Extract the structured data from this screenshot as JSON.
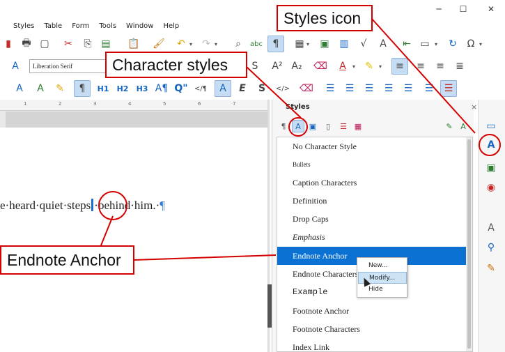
{
  "window": {
    "minimize": "─",
    "maximize": "☐",
    "close": "✕"
  },
  "menu": [
    "Styles",
    "Table",
    "Form",
    "Tools",
    "Window",
    "Help"
  ],
  "toolbar": {
    "font_name": "Liberation Serif"
  },
  "ruler": {
    "ticks": [
      "1",
      "2",
      "3",
      "4",
      "5",
      "6",
      "7"
    ]
  },
  "document": {
    "text_before": "e·heard·quiet·steps",
    "text_after": "·behind·him.·",
    "pilcrow": "¶"
  },
  "styles_panel": {
    "title": "Styles",
    "close": "×",
    "items": [
      "No Character Style",
      "Bullets",
      "Caption Characters",
      "Definition",
      "Drop Caps",
      "Emphasis",
      "Endnote Anchor",
      "Endnote Characters",
      "Example",
      "Footnote Anchor",
      "Footnote Characters",
      "Index Link"
    ],
    "selected": "Endnote Anchor"
  },
  "context_menu": {
    "items": [
      "New...",
      "Modify...",
      "Hide"
    ]
  },
  "callouts": {
    "styles_icon": "Styles icon",
    "character_styles": "Character styles",
    "endnote_anchor": "Endnote Anchor"
  },
  "colors": {
    "callout_border": "#d40000",
    "selection": "#0b72d4",
    "active_button": "#c5dcf3"
  }
}
